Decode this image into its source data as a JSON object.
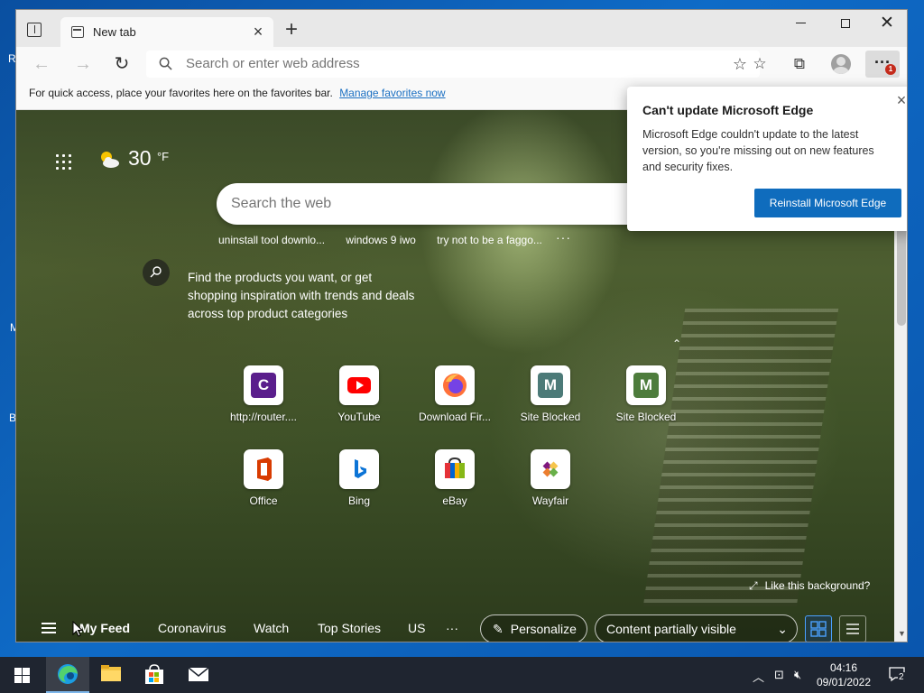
{
  "desktop": {
    "fragments": [
      "R",
      "M",
      "B"
    ]
  },
  "browser": {
    "tab_title": "New tab",
    "address_placeholder": "Search or enter web address",
    "more_badge": "1",
    "favorites_bar_text": "For quick access, place your favorites here on the favorites bar.",
    "favorites_bar_link": "Manage favorites now"
  },
  "newtab": {
    "weather_temp": "30",
    "weather_unit": "°F",
    "search_placeholder": "Search the web",
    "suggestions": [
      "uninstall tool downlo...",
      "windows 9 iwo",
      "try not to be a faggo..."
    ],
    "suggestions_more": "···",
    "promo_text": "Find the products you want, or get shopping inspiration with trends and deals across top product categories",
    "tiles": [
      {
        "label": "http://router....",
        "icon": "router-c-icon"
      },
      {
        "label": "YouTube",
        "icon": "youtube-icon"
      },
      {
        "label": "Download Fir...",
        "icon": "firefox-icon"
      },
      {
        "label": "Site Blocked",
        "icon": "site-blocked-m-icon"
      },
      {
        "label": "Site Blocked",
        "icon": "site-blocked-m-icon"
      },
      {
        "label": "Office",
        "icon": "office-icon"
      },
      {
        "label": "Bing",
        "icon": "bing-icon"
      },
      {
        "label": "eBay",
        "icon": "ebay-icon"
      },
      {
        "label": "Wayfair",
        "icon": "wayfair-icon"
      }
    ],
    "like_background": "Like this background?",
    "feed": {
      "items": [
        "My Feed",
        "Coronavirus",
        "Watch",
        "Top Stories",
        "US"
      ],
      "more": "···",
      "personalize": "Personalize",
      "content_visibility": "Content partially visible"
    }
  },
  "popup": {
    "title": "Can't update Microsoft Edge",
    "body": "Microsoft Edge couldn't update to the latest version, so you're missing out on new features and security fixes.",
    "button": "Reinstall Microsoft Edge"
  },
  "taskbar": {
    "time": "04:16",
    "date": "09/01/2022",
    "notification_count": "2"
  },
  "colors": {
    "accent": "#0f6cbd",
    "badge": "#c42b1c",
    "taskbar": "#1f2530"
  }
}
